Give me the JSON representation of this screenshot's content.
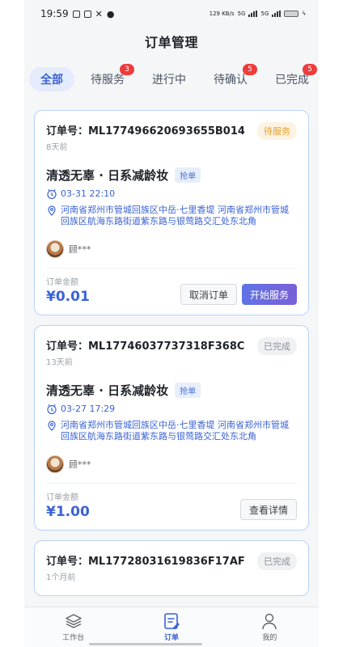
{
  "status_bar": {
    "time": "19:59",
    "net_speed": "129 KB/s",
    "sim1": "5G",
    "sim2": "5G"
  },
  "header": {
    "title": "订单管理"
  },
  "tabs": [
    {
      "label": "全部",
      "active": true,
      "badge": ""
    },
    {
      "label": "待服务",
      "active": false,
      "badge": "3"
    },
    {
      "label": "进行中",
      "active": false,
      "badge": ""
    },
    {
      "label": "待确认",
      "active": false,
      "badge": "5"
    },
    {
      "label": "已完成",
      "active": false,
      "badge": "5"
    }
  ],
  "orders": [
    {
      "order_label": "订单号：ML177496620693655B014",
      "time_ago": "8天前",
      "status": "待服务",
      "service_name": "清透无辜 · 日系减龄妆",
      "tag": "抢单",
      "datetime": "03-31 22:10",
      "address": "河南省郑州市管城回族区中岳·七里香堤 河南省郑州市管城回族区航海东路街道紫东路与银莺路交汇处东北角",
      "user": "顾***",
      "amount_label": "订单金额",
      "amount": "¥0.01",
      "btn_cancel": "取消订单",
      "btn_start": "开始服务"
    },
    {
      "order_label": "订单号：ML17746037737318F368C",
      "time_ago": "13天前",
      "status": "已完成",
      "service_name": "清透无辜 · 日系减龄妆",
      "tag": "抢单",
      "datetime": "03-27 17:29",
      "address": "河南省郑州市管城回族区中岳·七里香堤 河南省郑州市管城回族区航海东路街道紫东路与银莺路交汇处东北角",
      "user": "顾***",
      "amount_label": "订单金额",
      "amount": "¥1.00",
      "btn_detail": "查看详情"
    },
    {
      "order_label": "订单号：ML17728031619836F17AF",
      "time_ago": "1个月前",
      "status": "已完成"
    }
  ],
  "bottom_nav": [
    {
      "label": "工作台",
      "icon": "layers-icon",
      "active": false
    },
    {
      "label": "订单",
      "icon": "order-icon",
      "active": true
    },
    {
      "label": "我的",
      "icon": "person-icon",
      "active": false
    }
  ],
  "colors": {
    "accent": "#3a63d6",
    "badge_red": "#ee3b3b",
    "pending": "#e5a02e",
    "card_border": "#b9d3f7"
  }
}
